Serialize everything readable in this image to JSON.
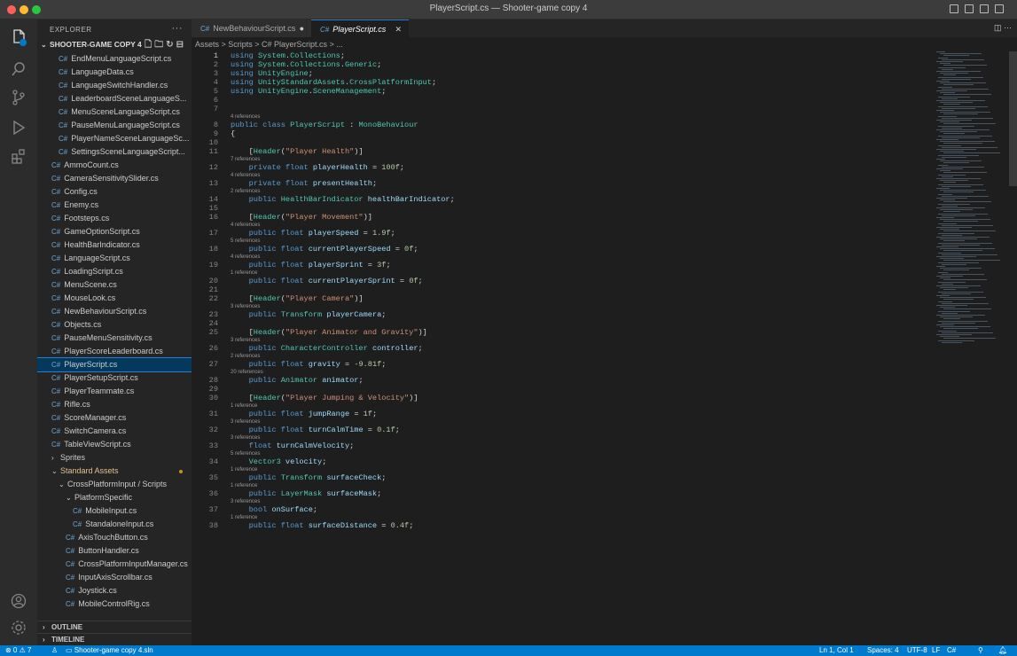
{
  "window": {
    "title": "PlayerScript.cs — Shooter-game copy 4"
  },
  "sidebar": {
    "header": "EXPLORER",
    "project": "SHOOTER-GAME COPY 4",
    "items": [
      {
        "label": "EndMenuLanguageScript.cs",
        "depth": 2,
        "type": "file"
      },
      {
        "label": "LanguageData.cs",
        "depth": 2,
        "type": "file"
      },
      {
        "label": "LanguageSwitchHandler.cs",
        "depth": 2,
        "type": "file"
      },
      {
        "label": "LeaderboardSceneLanguageS...",
        "depth": 2,
        "type": "file"
      },
      {
        "label": "MenuSceneLanguageScript.cs",
        "depth": 2,
        "type": "file"
      },
      {
        "label": "PauseMenuLanguageScript.cs",
        "depth": 2,
        "type": "file"
      },
      {
        "label": "PlayerNameSceneLanguageSc...",
        "depth": 2,
        "type": "file"
      },
      {
        "label": "SettingsSceneLanguageScript...",
        "depth": 2,
        "type": "file"
      },
      {
        "label": "AmmoCount.cs",
        "depth": 1,
        "type": "file"
      },
      {
        "label": "CameraSensitivitySlider.cs",
        "depth": 1,
        "type": "file"
      },
      {
        "label": "Config.cs",
        "depth": 1,
        "type": "file"
      },
      {
        "label": "Enemy.cs",
        "depth": 1,
        "type": "file"
      },
      {
        "label": "Footsteps.cs",
        "depth": 1,
        "type": "file"
      },
      {
        "label": "GameOptionScript.cs",
        "depth": 1,
        "type": "file"
      },
      {
        "label": "HealthBarIndicator.cs",
        "depth": 1,
        "type": "file"
      },
      {
        "label": "LanguageScript.cs",
        "depth": 1,
        "type": "file"
      },
      {
        "label": "LoadingScript.cs",
        "depth": 1,
        "type": "file"
      },
      {
        "label": "MenuScene.cs",
        "depth": 1,
        "type": "file"
      },
      {
        "label": "MouseLook.cs",
        "depth": 1,
        "type": "file"
      },
      {
        "label": "NewBehaviourScript.cs",
        "depth": 1,
        "type": "file"
      },
      {
        "label": "Objects.cs",
        "depth": 1,
        "type": "file"
      },
      {
        "label": "PauseMenuSensitivity.cs",
        "depth": 1,
        "type": "file"
      },
      {
        "label": "PlayerScoreLeaderboard.cs",
        "depth": 1,
        "type": "file"
      },
      {
        "label": "PlayerScript.cs",
        "depth": 1,
        "type": "file",
        "selected": true
      },
      {
        "label": "PlayerSetupScript.cs",
        "depth": 1,
        "type": "file"
      },
      {
        "label": "PlayerTeammate.cs",
        "depth": 1,
        "type": "file"
      },
      {
        "label": "Rifle.cs",
        "depth": 1,
        "type": "file"
      },
      {
        "label": "ScoreManager.cs",
        "depth": 1,
        "type": "file"
      },
      {
        "label": "SwitchCamera.cs",
        "depth": 1,
        "type": "file"
      },
      {
        "label": "TableViewScript.cs",
        "depth": 1,
        "type": "file"
      },
      {
        "label": "Sprites",
        "depth": 1,
        "type": "folder-closed"
      },
      {
        "label": "Standard Assets",
        "depth": 1,
        "type": "folder-open",
        "modified": true
      },
      {
        "label": "CrossPlatformInput / Scripts",
        "depth": 2,
        "type": "folder-open"
      },
      {
        "label": "PlatformSpecific",
        "depth": 3,
        "type": "folder-open"
      },
      {
        "label": "MobileInput.cs",
        "depth": 4,
        "type": "file"
      },
      {
        "label": "StandaloneInput.cs",
        "depth": 4,
        "type": "file"
      },
      {
        "label": "AxisTouchButton.cs",
        "depth": 3,
        "type": "file"
      },
      {
        "label": "ButtonHandler.cs",
        "depth": 3,
        "type": "file"
      },
      {
        "label": "CrossPlatformInputManager.cs",
        "depth": 3,
        "type": "file"
      },
      {
        "label": "InputAxisScrollbar.cs",
        "depth": 3,
        "type": "file"
      },
      {
        "label": "Joystick.cs",
        "depth": 3,
        "type": "file"
      },
      {
        "label": "MobileControlRig.cs",
        "depth": 3,
        "type": "file"
      }
    ],
    "outline": "OUTLINE",
    "timeline": "TIMELINE"
  },
  "tabs": [
    {
      "label": "NewBehaviourScript.cs",
      "dirty": "●"
    },
    {
      "label": "PlayerScript.cs",
      "close": "✕"
    }
  ],
  "breadcrumb": "Assets > Scripts > C# PlayerScript.cs > ...",
  "code_lines": [
    {
      "n": "1",
      "lens": "",
      "code": "using System.Collections;"
    },
    {
      "n": "2",
      "lens": "",
      "code": "using System.Collections.Generic;"
    },
    {
      "n": "3",
      "lens": "",
      "code": "using UnityEngine;"
    },
    {
      "n": "4",
      "lens": "",
      "code": "using UnityStandardAssets.CrossPlatformInput;"
    },
    {
      "n": "5",
      "lens": "",
      "code": "using UnityEngine.SceneManagement;"
    },
    {
      "n": "6",
      "lens": "",
      "code": ""
    },
    {
      "n": "7",
      "lens": "",
      "code": ""
    },
    {
      "n": "8",
      "lens": "4 references",
      "code": "public class PlayerScript : MonoBehaviour"
    },
    {
      "n": "9",
      "lens": "",
      "code": "{"
    },
    {
      "n": "10",
      "lens": "",
      "code": ""
    },
    {
      "n": "11",
      "lens": "",
      "code": "    [Header(\"Player Health\")]"
    },
    {
      "n": "12",
      "lens": "7 references",
      "code": "    private float playerHealth = 100f;"
    },
    {
      "n": "13",
      "lens": "4 references",
      "code": "    private float presentHealth;"
    },
    {
      "n": "14",
      "lens": "2 references",
      "code": "    public HealthBarIndicator healthBarIndicator;"
    },
    {
      "n": "15",
      "lens": "",
      "code": ""
    },
    {
      "n": "16",
      "lens": "",
      "code": "    [Header(\"Player Movement\")]"
    },
    {
      "n": "17",
      "lens": "4 references",
      "code": "    public float playerSpeed = 1.9f;"
    },
    {
      "n": "18",
      "lens": "5 references",
      "code": "    public float currentPlayerSpeed = 0f;"
    },
    {
      "n": "19",
      "lens": "4 references",
      "code": "    public float playerSprint = 3f;"
    },
    {
      "n": "20",
      "lens": "1 reference",
      "code": "    public float currentPlayerSprint = 0f;"
    },
    {
      "n": "21",
      "lens": "",
      "code": ""
    },
    {
      "n": "22",
      "lens": "",
      "code": "    [Header(\"Player Camera\")]"
    },
    {
      "n": "23",
      "lens": "3 references",
      "code": "    public Transform playerCamera;"
    },
    {
      "n": "24",
      "lens": "",
      "code": ""
    },
    {
      "n": "25",
      "lens": "",
      "code": "    [Header(\"Player Animator and Gravity\")]"
    },
    {
      "n": "26",
      "lens": "3 references",
      "code": "    public CharacterController controller;"
    },
    {
      "n": "27",
      "lens": "2 references",
      "code": "    public float gravity = -9.81f;"
    },
    {
      "n": "28",
      "lens": "20 references",
      "code": "    public Animator animator;"
    },
    {
      "n": "29",
      "lens": "",
      "code": ""
    },
    {
      "n": "30",
      "lens": "",
      "code": "    [Header(\"Player Jumping & Velocity\")]"
    },
    {
      "n": "31",
      "lens": "1 reference",
      "code": "    public float jumpRange = 1f;"
    },
    {
      "n": "32",
      "lens": "3 references",
      "code": "    public float turnCalmTime = 0.1f;"
    },
    {
      "n": "33",
      "lens": "3 references",
      "code": "    float turnCalmVelocity;"
    },
    {
      "n": "34",
      "lens": "5 references",
      "code": "    Vector3 velocity;"
    },
    {
      "n": "35",
      "lens": "1 reference",
      "code": "    public Transform surfaceCheck;"
    },
    {
      "n": "36",
      "lens": "1 reference",
      "code": "    public LayerMask surfaceMask;"
    },
    {
      "n": "37",
      "lens": "3 references",
      "code": "    bool onSurface;"
    },
    {
      "n": "38",
      "lens": "1 reference",
      "code": "    public float surfaceDistance = 0.4f;"
    }
  ],
  "status": {
    "problems": "⊗ 0 ⚠ 7",
    "folder": "Shooter-game copy 4.sln",
    "position": "Ln 1, Col 1",
    "spaces": "Spaces: 4",
    "encoding": "UTF-8",
    "eol": "LF",
    "language": "C#"
  },
  "colors": {
    "accent": "#007acc",
    "keyword": "#569cd6",
    "type": "#4ec9b0",
    "string": "#ce9178",
    "number": "#b5cea8",
    "variable": "#9cdcfe"
  }
}
